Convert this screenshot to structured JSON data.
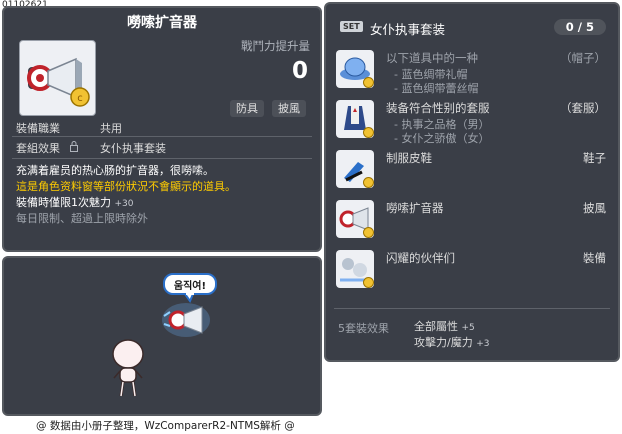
{
  "item_id": "01102621",
  "item": {
    "title": "嘮嗦扩音器",
    "power_label": "戰鬥力提升量",
    "power_value": "0",
    "tags": [
      "防具",
      "披風"
    ],
    "job_label": "裝備職業",
    "job_value": "共用",
    "set_label": "套組效果",
    "set_value": "女仆执事套装",
    "desc_line1": "充满着雇员的热心肠的扩音器，很嘮嗦。",
    "desc_line2": "這是角色资料窗等部份狀況不會顯示的道具。",
    "desc_line3": "裝備時僅限1次魅力",
    "desc_line3_bonus": "+30",
    "desc_line4": "每日限制、超過上限時除外"
  },
  "preview": {
    "bubble_text": "움직여!"
  },
  "footer": "@ 数据由小册子整理，WzComparerR2-NTMS解析 @",
  "set": {
    "badge": "SET",
    "name": "女仆执事套装",
    "count": "0 / 5",
    "items": [
      {
        "name": "以下道具中的一种",
        "slot": "（帽子）",
        "subs": [
          "- 蓝色绸带礼帽",
          "- 蓝色绸带蕾丝帽"
        ],
        "icon": "hat-icon"
      },
      {
        "name": "装备符合性别的套服",
        "slot": "（套服）",
        "subs": [
          "- 执事之品格（男）",
          "- 女仆之骄傲（女）"
        ],
        "icon": "suit-icon"
      },
      {
        "name": "制服皮鞋",
        "slot": "鞋子",
        "subs": [],
        "icon": "shoes-icon"
      },
      {
        "name": "嘮嗦扩音器",
        "slot": "披風",
        "subs": [],
        "icon": "megaphone-icon"
      },
      {
        "name": "闪耀的伙伴们",
        "slot": "裝備",
        "subs": [],
        "icon": "companions-icon"
      }
    ],
    "effect_label": "5套裝效果",
    "effect_all": "全部屬性",
    "effect_all_val": "+5",
    "effect_atk": "攻擊力/魔力",
    "effect_atk_val": "+3"
  },
  "colors": {
    "panel": "#3a3e47",
    "highlight": "#ffcc00",
    "accent_blue": "#2a6fc9"
  }
}
